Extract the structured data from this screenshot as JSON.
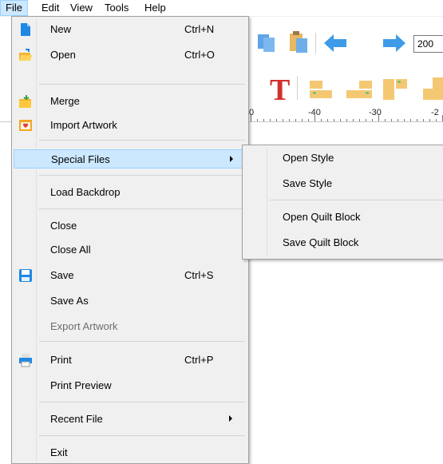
{
  "menubar": {
    "items": [
      "File",
      "Edit",
      "View",
      "Tools",
      "Help"
    ],
    "active": "File"
  },
  "toolbar": {
    "zoom_value": "200",
    "text_tool_glyph": "T"
  },
  "ruler": {
    "labels": [
      "0",
      "-40",
      "-30",
      "-2"
    ]
  },
  "file_menu": {
    "items": [
      {
        "label": "New",
        "shortcut": "Ctrl+N",
        "icon": "new-file-icon"
      },
      {
        "label": "Open",
        "shortcut": "Ctrl+O",
        "icon": "open-folder-icon"
      },
      {
        "label": "Merge",
        "icon": "merge-folder-icon"
      },
      {
        "label": "Import Artwork",
        "icon": "import-artwork-icon"
      },
      {
        "label": "Special Files",
        "submenu": true,
        "highlighted": true
      },
      {
        "label": "Load Backdrop"
      },
      {
        "label": "Close"
      },
      {
        "label": "Close All"
      },
      {
        "label": "Save",
        "shortcut": "Ctrl+S",
        "icon": "save-disk-icon"
      },
      {
        "label": "Save As"
      },
      {
        "label": "Export Artwork",
        "disabled": true
      },
      {
        "label": "Print",
        "shortcut": "Ctrl+P",
        "icon": "printer-icon"
      },
      {
        "label": "Print Preview"
      },
      {
        "label": "Recent File",
        "submenu": true
      },
      {
        "label": "Exit"
      }
    ]
  },
  "special_files_submenu": {
    "items": [
      "Open Style",
      "Save Style",
      "Open Quilt Block",
      "Save Quilt Block"
    ]
  },
  "colors": {
    "highlight": "#cce8ff",
    "highlight_border": "#99d1ff",
    "menu_bg": "#f0f0f0",
    "accent_blue": "#2b8fe0",
    "toolbar_red": "#d32f2f"
  }
}
